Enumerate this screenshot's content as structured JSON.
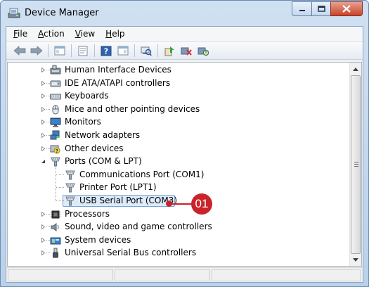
{
  "window": {
    "title": "Device Manager",
    "caption_buttons": [
      "minimize",
      "maximize",
      "close"
    ]
  },
  "menu": [
    {
      "label": "File",
      "underline": "F",
      "rest": "ile"
    },
    {
      "label": "Action",
      "underline": "A",
      "rest": "ction"
    },
    {
      "label": "View",
      "underline": "V",
      "rest": "iew"
    },
    {
      "label": "Help",
      "underline": "H",
      "rest": "elp"
    }
  ],
  "toolbar": {
    "icons": [
      "back-arrow-icon",
      "forward-arrow-icon",
      "show-hide-console-tree-icon",
      "properties-icon",
      "help-icon",
      "view-icon",
      "scan-hardware-icon",
      "update-driver-icon",
      "uninstall-icon",
      "disable-icon"
    ]
  },
  "tree": {
    "items": [
      {
        "label": "Human Interface Devices",
        "icon": "hid-icon",
        "level": 0,
        "expander": "collapsed"
      },
      {
        "label": "IDE ATA/ATAPI controllers",
        "icon": "ide-controller-icon",
        "level": 0,
        "expander": "collapsed"
      },
      {
        "label": "Keyboards",
        "icon": "keyboard-icon",
        "level": 0,
        "expander": "collapsed"
      },
      {
        "label": "Mice and other pointing devices",
        "icon": "mouse-icon",
        "level": 0,
        "expander": "collapsed"
      },
      {
        "label": "Monitors",
        "icon": "monitor-icon",
        "level": 0,
        "expander": "collapsed"
      },
      {
        "label": "Network adapters",
        "icon": "network-adapter-icon",
        "level": 0,
        "expander": "collapsed"
      },
      {
        "label": "Other devices",
        "icon": "unknown-device-icon",
        "level": 0,
        "expander": "collapsed"
      },
      {
        "label": "Ports (COM & LPT)",
        "icon": "port-icon",
        "level": 0,
        "expander": "expanded"
      },
      {
        "label": "Communications Port (COM1)",
        "icon": "port-icon",
        "level": 1
      },
      {
        "label": "Printer Port (LPT1)",
        "icon": "port-icon",
        "level": 1
      },
      {
        "label": "USB Serial Port (COM3)",
        "icon": "port-icon",
        "level": 1,
        "selected": true
      },
      {
        "label": "Processors",
        "icon": "processor-icon",
        "level": 0,
        "expander": "collapsed"
      },
      {
        "label": "Sound, video and game controllers",
        "icon": "sound-icon",
        "level": 0,
        "expander": "collapsed"
      },
      {
        "label": "System devices",
        "icon": "system-device-icon",
        "level": 0,
        "expander": "collapsed"
      },
      {
        "label": "Universal Serial Bus controllers",
        "icon": "usb-icon",
        "level": 0,
        "expander": "collapsed"
      }
    ]
  },
  "callout": {
    "label": "01"
  },
  "colors": {
    "accent_red": "#c8242a",
    "selection_fill": "#dcebfc",
    "selection_border": "#7da2ce"
  }
}
